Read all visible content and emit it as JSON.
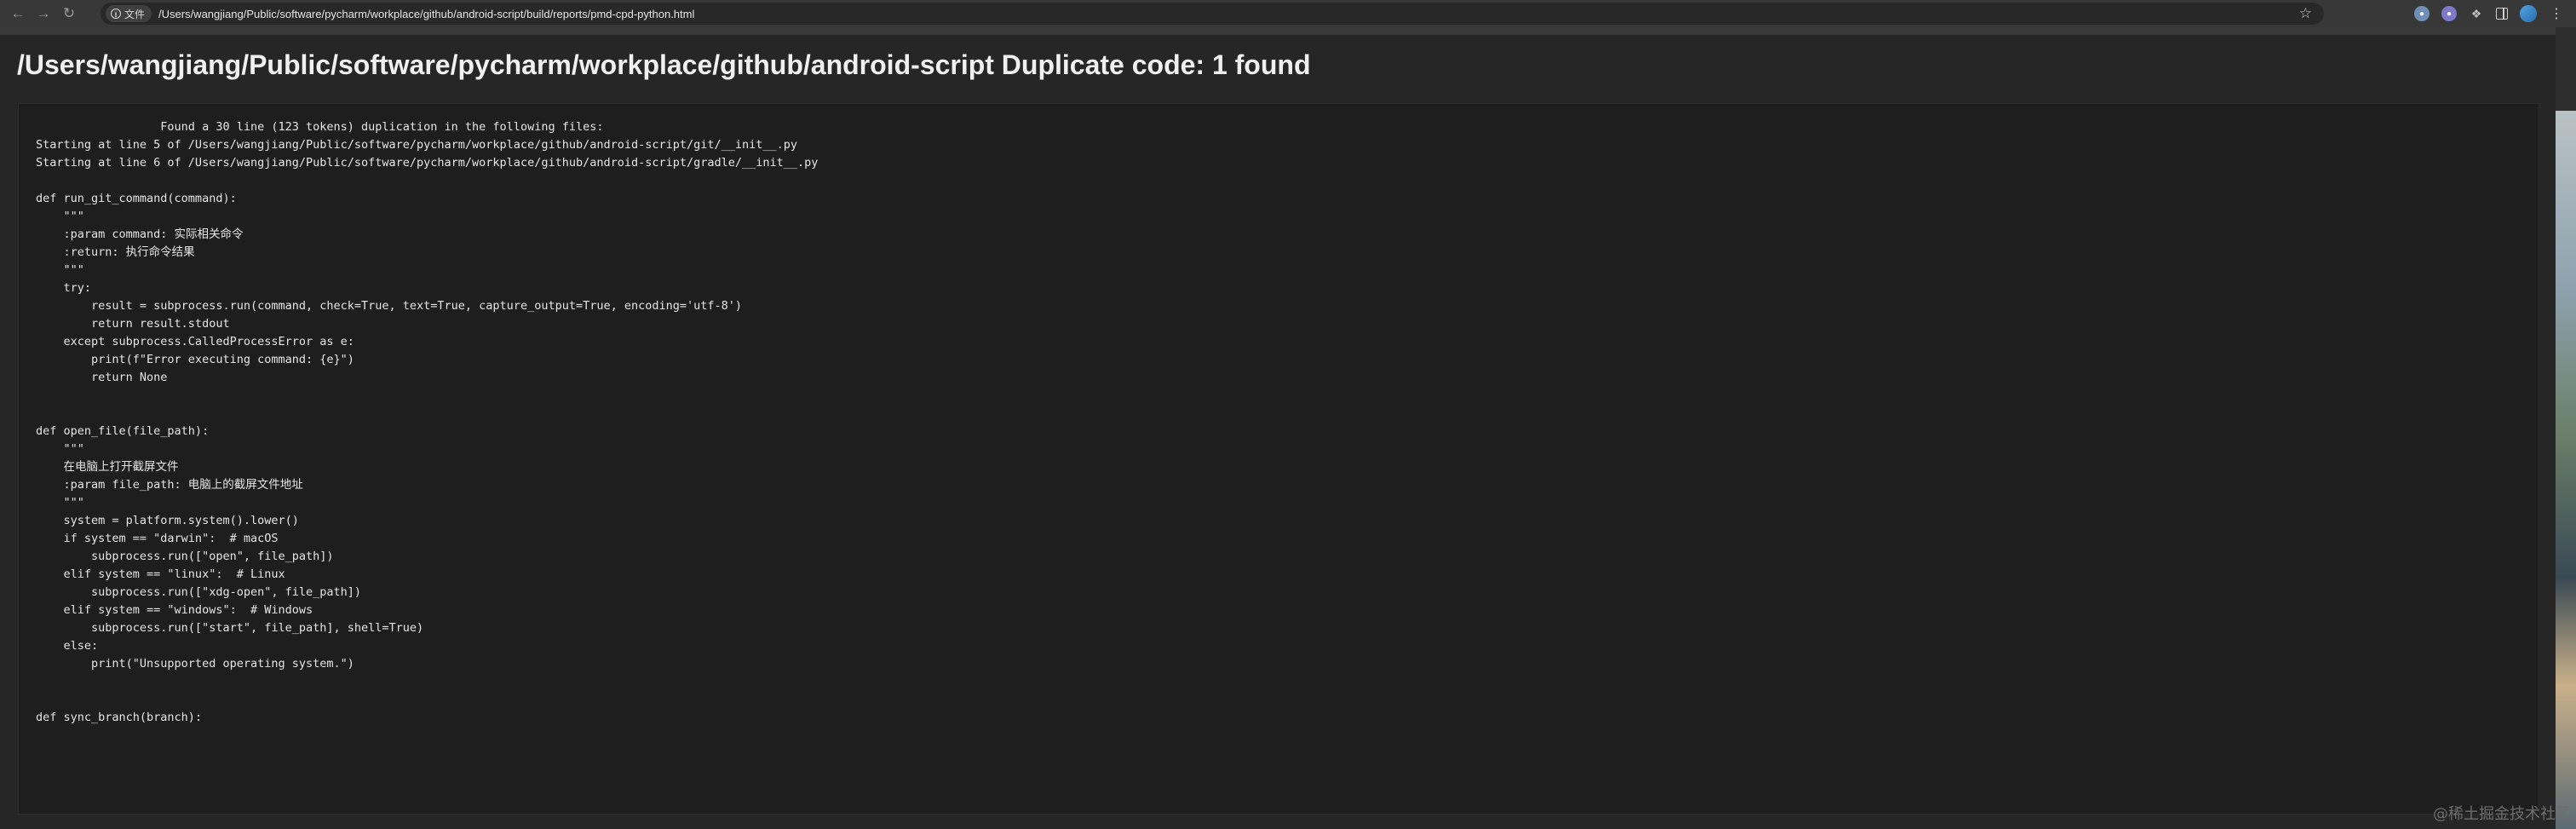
{
  "browser": {
    "back_icon": "arrow-left-icon",
    "forward_icon": "arrow-right-icon",
    "reload_icon": "reload-icon",
    "info_label": "文件",
    "url": "/Users/wangjiang/Public/software/pycharm/workplace/github/android-script/build/reports/pmd-cpd-python.html",
    "bookmark_icon": "star-icon",
    "extensions": [
      "extension-icon",
      "extension-icon",
      "puzzle-icon",
      "side-panel-icon",
      "profile-avatar",
      "menu-icon"
    ]
  },
  "page": {
    "title": "/Users/wangjiang/Public/software/pycharm/workplace/github/android-script Duplicate code: 1 found",
    "code": "                  Found a 30 line (123 tokens) duplication in the following files:\nStarting at line 5 of /Users/wangjiang/Public/software/pycharm/workplace/github/android-script/git/__init__.py\nStarting at line 6 of /Users/wangjiang/Public/software/pycharm/workplace/github/android-script/gradle/__init__.py\n\ndef run_git_command(command):\n    \"\"\"\n    :param command: 实际相关命令\n    :return: 执行命令结果\n    \"\"\"\n    try:\n        result = subprocess.run(command, check=True, text=True, capture_output=True, encoding='utf-8')\n        return result.stdout\n    except subprocess.CalledProcessError as e:\n        print(f\"Error executing command: {e}\")\n        return None\n\n\ndef open_file(file_path):\n    \"\"\"\n    在电脑上打开截屏文件\n    :param file_path: 电脑上的截屏文件地址\n    \"\"\"\n    system = platform.system().lower()\n    if system == \"darwin\":  # macOS\n        subprocess.run([\"open\", file_path])\n    elif system == \"linux\":  # Linux\n        subprocess.run([\"xdg-open\", file_path])\n    elif system == \"windows\":  # Windows\n        subprocess.run([\"start\", file_path], shell=True)\n    else:\n        print(\"Unsupported operating system.\")\n\n\ndef sync_branch(branch):"
  },
  "watermark": "@稀土掘金技术社区"
}
